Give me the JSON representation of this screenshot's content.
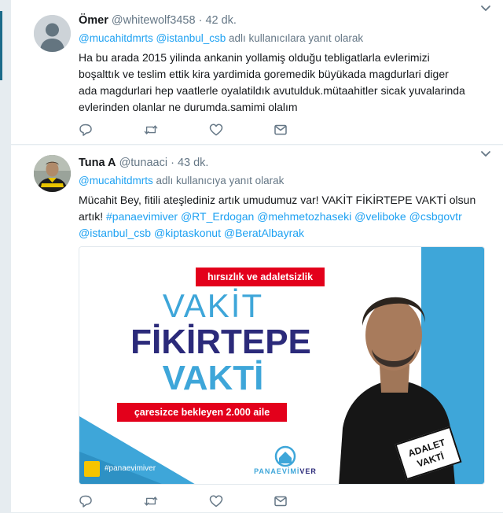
{
  "tweets": [
    {
      "name": "Ömer",
      "handle": "@whitewolf3458",
      "separator": "·",
      "time": "42 dk.",
      "reply_prefix_mentions": [
        "@mucahitdmrts",
        "@istanbul_csb"
      ],
      "reply_suffix": "adlı kullanıcılara yanıt olarak",
      "text_lines": [
        "Ha bu arada 2015 yilinda ankanin yollamiş olduğu tebligatlarla evlerimizi",
        "boşalttık ve teslim ettik kira yardimida goremedik büyükada  magdurlari diger",
        "ada magdurlari hep vaatlerle oyalatildık avutulduk.mütaahitler sicak yuvalarinda",
        "evlerinden olanlar ne durumda.samimi olalım"
      ],
      "icons": [
        "reply-icon",
        "retweet-icon",
        "like-icon",
        "message-icon"
      ]
    },
    {
      "name": "Tuna A",
      "handle": "@tunaaci",
      "separator": "·",
      "time": "43 dk.",
      "reply_mention": "@mucahitdmrts",
      "reply_suffix": "adlı kullanıcıya yanıt olarak",
      "text_line1": "Mücahit Bey, fitili ateşlediniz artık umudumuz var!  VAKİT FİKİRTEPE VAKTİ olsun",
      "text_line2_plain": "artık!",
      "hashtags_line2": [
        "#panaevimiver",
        "@RT_Erdogan",
        "@mehmetozhaseki",
        "@veliboke",
        "@csbgovtr"
      ],
      "mentions_line3": [
        "@istanbul_csb",
        "@kiptaskonut",
        "@BeratAlbayrak"
      ],
      "media": {
        "banner_top": "hırsızlık ve adaletsizlik",
        "word1": "VAKİT",
        "word2": "FİKİRTEPE",
        "word3": "VAKTİ",
        "banner_bottom": "çaresizce bekleyen 2.000 aile",
        "hashtag": "#panaevimiver",
        "brand_part1": "PANAEVİMİ",
        "brand_part2": "VER",
        "stamp_line1": "ADALET",
        "stamp_line2": "VAKTİ"
      },
      "icons": [
        "reply-icon",
        "retweet-icon",
        "like-icon",
        "message-icon"
      ]
    }
  ],
  "colors": {
    "link": "#1da1f2",
    "muted": "#657786",
    "text": "#14171a",
    "banner_red": "#e3001b",
    "headline_blue": "#3ea6d9",
    "headline_navy": "#2b2a7a"
  }
}
